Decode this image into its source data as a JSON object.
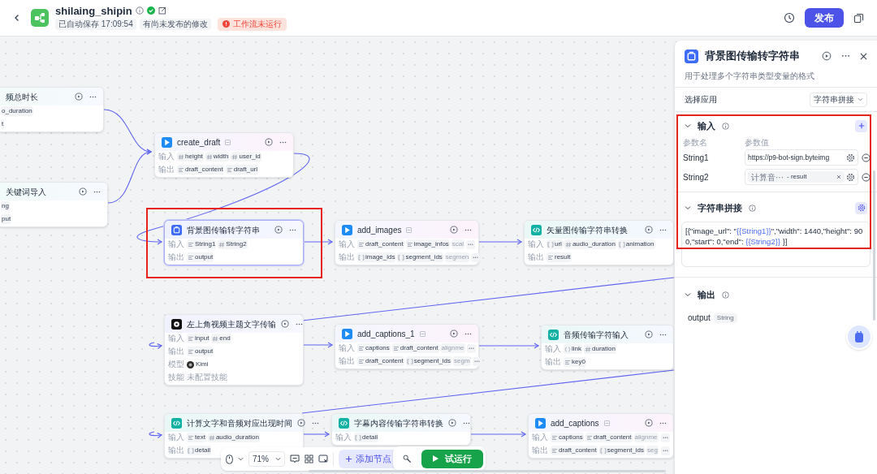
{
  "header": {
    "title": "shilaing_shipin",
    "published_ok": true,
    "tags": [
      "已自动保存 17:09:54",
      "有尚未发布的修改"
    ],
    "status": "工作流未运行",
    "publish_button": "发布"
  },
  "nodes": [
    {
      "kind": "clipped",
      "title": "频总时长",
      "selected": false,
      "rows": [
        {
          "kind": "params",
          "params": [
            {
              "name": "o_duration"
            }
          ]
        },
        {
          "kind": "params",
          "params": [
            {
              "name": "t"
            }
          ]
        }
      ]
    },
    {
      "kind": "clipped",
      "title": "关键词导入",
      "selected": false,
      "rows": [
        {
          "kind": "params",
          "params": [
            {
              "name": "ng"
            }
          ]
        },
        {
          "kind": "params",
          "params": [
            {
              "name": "put"
            }
          ]
        }
      ]
    },
    {
      "kind": "plugin",
      "title": "create_draft",
      "selected": false,
      "rows": [
        {
          "kind": "params",
          "label": "输入",
          "params": [
            {
              "name": "height",
              "kind": "num"
            },
            {
              "name": "width",
              "kind": "num"
            },
            {
              "name": "user_id",
              "kind": "num"
            }
          ]
        },
        {
          "kind": "params",
          "label": "输出",
          "params": [
            {
              "name": "draft_content",
              "kind": "str"
            },
            {
              "name": "draft_url",
              "kind": "str"
            }
          ]
        }
      ]
    },
    {
      "kind": "tool",
      "title": "背景图传输转字符串",
      "selected": true,
      "rows": [
        {
          "kind": "params",
          "label": "输入",
          "params": [
            {
              "name": "String1",
              "kind": "str"
            },
            {
              "name": "String2",
              "kind": "num"
            }
          ]
        },
        {
          "kind": "params",
          "label": "输出",
          "params": [
            {
              "name": "output",
              "kind": "str"
            }
          ]
        }
      ]
    },
    {
      "kind": "plugin",
      "title": "add_images",
      "selected": false,
      "rows": [
        {
          "kind": "params",
          "label": "输入",
          "params": [
            {
              "name": "draft_content",
              "kind": "str"
            },
            {
              "name": "image_infos",
              "kind": "str"
            }
          ],
          "overflow": "scal"
        },
        {
          "kind": "params",
          "label": "输出",
          "params": [
            {
              "name": "image_ids",
              "kind": "arr"
            },
            {
              "name": "segment_ids",
              "kind": "arr"
            }
          ],
          "overflow": "segmen"
        }
      ]
    },
    {
      "kind": "code",
      "title": "矢量图传输字符串转换",
      "selected": false,
      "rows": [
        {
          "kind": "params",
          "label": "输入",
          "params": [
            {
              "name": "url",
              "kind": "arr"
            },
            {
              "name": "audio_duration",
              "kind": "num"
            },
            {
              "name": "animation",
              "kind": "arr"
            }
          ]
        },
        {
          "kind": "params",
          "label": "输出",
          "params": [
            {
              "name": "result",
              "kind": "str"
            }
          ]
        }
      ]
    },
    {
      "kind": "llm",
      "title": "左上角视频主题文字传输",
      "selected": false,
      "rows": [
        {
          "kind": "params",
          "label": "输入",
          "params": [
            {
              "name": "input",
              "kind": "str"
            },
            {
              "name": "end",
              "kind": "num"
            }
          ]
        },
        {
          "kind": "params",
          "label": "输出",
          "params": [
            {
              "name": "output",
              "kind": "str"
            }
          ]
        },
        {
          "kind": "model",
          "label": "模型",
          "value": "Kimi"
        },
        {
          "kind": "note",
          "label": "技能",
          "value": "未配置技能"
        }
      ]
    },
    {
      "kind": "plugin",
      "title": "add_captions_1",
      "selected": false,
      "rows": [
        {
          "kind": "params",
          "label": "输入",
          "params": [
            {
              "name": "captions",
              "kind": "str"
            },
            {
              "name": "draft_content",
              "kind": "str"
            }
          ],
          "overflow": "alignme"
        },
        {
          "kind": "params",
          "label": "输出",
          "params": [
            {
              "name": "draft_content",
              "kind": "str"
            },
            {
              "name": "segment_ids",
              "kind": "arr"
            }
          ],
          "overflow": "segm"
        }
      ]
    },
    {
      "kind": "code",
      "title": "音频传输字符输入",
      "selected": false,
      "rows": [
        {
          "kind": "params",
          "label": "输入",
          "params": [
            {
              "name": "link",
              "kind": "obj"
            },
            {
              "name": "duration",
              "kind": "num"
            }
          ]
        },
        {
          "kind": "params",
          "label": "输出",
          "params": [
            {
              "name": "key0",
              "kind": "str"
            }
          ]
        }
      ]
    },
    {
      "kind": "code",
      "title": "计算文字和音频对应出现时间",
      "selected": false,
      "rows": [
        {
          "kind": "params",
          "label": "输入",
          "params": [
            {
              "name": "text",
              "kind": "str"
            },
            {
              "name": "audio_duration",
              "kind": "num"
            }
          ]
        },
        {
          "kind": "params",
          "label": "输出",
          "params": [
            {
              "name": "detail",
              "kind": "arr"
            }
          ]
        }
      ]
    },
    {
      "kind": "code",
      "title": "字幕内容传输字符串转换",
      "selected": false,
      "rows": [
        {
          "kind": "params",
          "label": "输入",
          "params": [
            {
              "name": "detail",
              "kind": "arr"
            }
          ]
        }
      ]
    },
    {
      "kind": "plugin",
      "title": "add_captions",
      "selected": false,
      "rows": [
        {
          "kind": "params",
          "label": "输入",
          "params": [
            {
              "name": "captions",
              "kind": "str"
            },
            {
              "name": "draft_content",
              "kind": "str"
            }
          ],
          "overflow": "alignme"
        },
        {
          "kind": "params",
          "label": "输出",
          "params": [
            {
              "name": "draft_content",
              "kind": "str"
            },
            {
              "name": "segment_ids",
              "kind": "arr"
            }
          ],
          "overflow": "seg"
        }
      ]
    }
  ],
  "toolbar": {
    "zoom": "71%",
    "add_node": "添加节点",
    "test_run": "试运行"
  },
  "panel": {
    "title": "背景图传输转字符串",
    "description": "用于处理多个字符串类型变量的格式",
    "app_label": "选择应用",
    "app_value": "字符串拼接",
    "input": {
      "title": "输入",
      "expanded": true,
      "columns": [
        "参数名",
        "参数值"
      ],
      "rows": [
        {
          "name": "String1",
          "kind": "value",
          "value": "https://p9-bot-sign.byteimg"
        },
        {
          "name": "String2",
          "kind": "reference",
          "source": "计算音···",
          "value": "- result"
        }
      ]
    },
    "concat": {
      "title": "字符串拼接",
      "expanded": true,
      "template": [
        {
          "kind": "literal",
          "text": "[{\"image_url\": \""
        },
        {
          "kind": "variable",
          "text": "{{String1}}"
        },
        {
          "kind": "literal",
          "text": "\",\"width\": 1440,\"height\": 900,\"start\": 0,\"end\": "
        },
        {
          "kind": "variable",
          "text": "{{String2}}"
        },
        {
          "kind": "literal",
          "text": " }]"
        }
      ]
    },
    "output": {
      "title": "输出",
      "expanded": true,
      "name": "output",
      "type": "String"
    }
  }
}
